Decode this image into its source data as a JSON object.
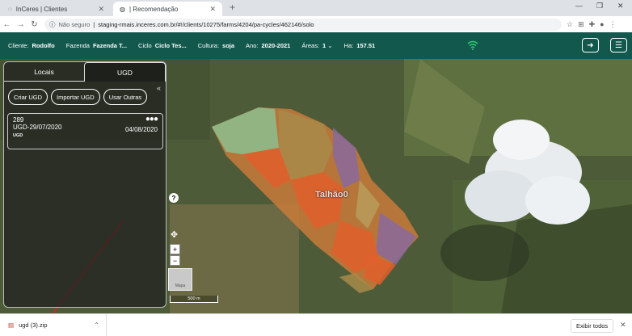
{
  "browser": {
    "tabs": [
      {
        "title": "InCeres | Clientes"
      },
      {
        "title": "| Recomendação"
      }
    ],
    "url_security": "Não seguro",
    "url": "staging-rmais.inceres.com.br/#!/clients/10275/farms/4204/pa-cycles/462146/solo"
  },
  "header": {
    "cliente_label": "Cliente:",
    "cliente_value": "Rodolfo",
    "fazenda_label": "Fazenda",
    "fazenda_value": "Fazenda T...",
    "ciclo_label": "Ciclo",
    "ciclo_value": "Ciclo Tes...",
    "cultura_label": "Cultura:",
    "cultura_value": "soja",
    "ano_label": "Ano:",
    "ano_value": "2020-2021",
    "areas_label": "Áreas:",
    "areas_value": "1",
    "ha_label": "Ha:",
    "ha_value": "157.51"
  },
  "panel": {
    "tabs": [
      {
        "label": "Locais"
      },
      {
        "label": "UGD"
      }
    ],
    "buttons": [
      {
        "label": "Criar UGD"
      },
      {
        "label": "Importar UGD"
      },
      {
        "label": "Usar Outras"
      }
    ],
    "card": {
      "id": "289",
      "name": "UGD-29/07/2020",
      "date": "04/08/2020",
      "tag": "UGD"
    }
  },
  "map": {
    "field_label": "Talhão0",
    "scale_label": "500 m",
    "thumb_label": "Mapa"
  },
  "downloads": {
    "file_name": "ugd (3).zip",
    "show_all": "Exibir todos"
  },
  "colors": {
    "header_bg": "#13584d",
    "accent_green": "#2ecc71"
  }
}
